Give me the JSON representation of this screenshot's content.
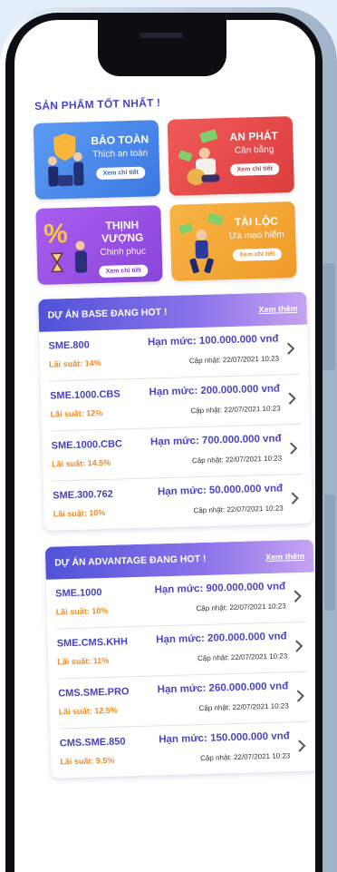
{
  "products_section": {
    "title": "SẢN PHẨM TỐT NHẤT !",
    "items": [
      {
        "name": "BẢO TOÀN",
        "tagline": "Thích an toàn",
        "button": "Xem chi tiết",
        "color": "#4a86ea",
        "btn_color": "#2f6ad8"
      },
      {
        "name": "AN PHÁT",
        "tagline": "Cân bằng",
        "button": "Xem chi tiết",
        "color": "#e94a4a",
        "btn_color": "#d93a3a"
      },
      {
        "name": "THỊNH VƯỢNG",
        "tagline": "Chinh phục",
        "button": "Xem chi tiết",
        "color": "#9b4fe0",
        "btn_color": "#8a3fd0"
      },
      {
        "name": "TÀI LỘC",
        "tagline": "Ưa mạo hiểm",
        "button": "Xem chi tiết",
        "color": "#f7a83a",
        "btn_color": "#e98f1c"
      }
    ]
  },
  "base_projects": {
    "title": "DỰ ÁN BASE ĐANG HOT !",
    "more": "Xem thêm",
    "rows": [
      {
        "name": "SME.800",
        "rate": "Lãi suất: 14%",
        "limit": "Hạn mức: 100.000.000 vnđ",
        "updated": "Cập nhật: 22/07/2021 10:23"
      },
      {
        "name": "SME.1000.CBS",
        "rate": "Lãi suất: 12%",
        "limit": "Hạn mức: 200.000.000 vnđ",
        "updated": "Cập nhật: 22/07/2021 10:23"
      },
      {
        "name": "SME.1000.CBC",
        "rate": "Lãi suất: 14.5%",
        "limit": "Hạn mức: 700.000.000 vnđ",
        "updated": "Cập nhật: 22/07/2021 10:23"
      },
      {
        "name": "SME.300.762",
        "rate": "Lãi suất: 10%",
        "limit": "Hạn mức: 50.000.000 vnđ",
        "updated": "Cập nhật: 22/07/2021 10:23"
      }
    ]
  },
  "advantage_projects": {
    "title": "DỰ ÁN ADVANTAGE ĐANG HOT !",
    "more": "Xem thêm",
    "rows": [
      {
        "name": "SME.1000",
        "rate": "Lãi suất: 10%",
        "limit": "Hạn mức: 900.000.000 vnđ",
        "updated": "Cập nhật: 22/07/2021 10:23"
      },
      {
        "name": "SME.CMS.KHH",
        "rate": "Lãi suất: 11%",
        "limit": "Hạn mức: 200.000.000 vnđ",
        "updated": "Cập nhật: 22/07/2021 10:23"
      },
      {
        "name": "CMS.SME.PRO",
        "rate": "Lãi suất: 12.5%",
        "limit": "Hạn mức: 260.000.000 vnđ",
        "updated": "Cập nhật: 22/07/2021 10:23"
      },
      {
        "name": "CMS.SME.850",
        "rate": "Lãi suất: 9.5%",
        "limit": "Hạn mức: 150.000.000 vnđ",
        "updated": "Cập nhật: 22/07/2021 10:23"
      }
    ]
  },
  "colors": {
    "accent": "#4a44c8",
    "rate": "#f08b21"
  },
  "icons": {
    "row_action": "chevron-right-icon"
  }
}
